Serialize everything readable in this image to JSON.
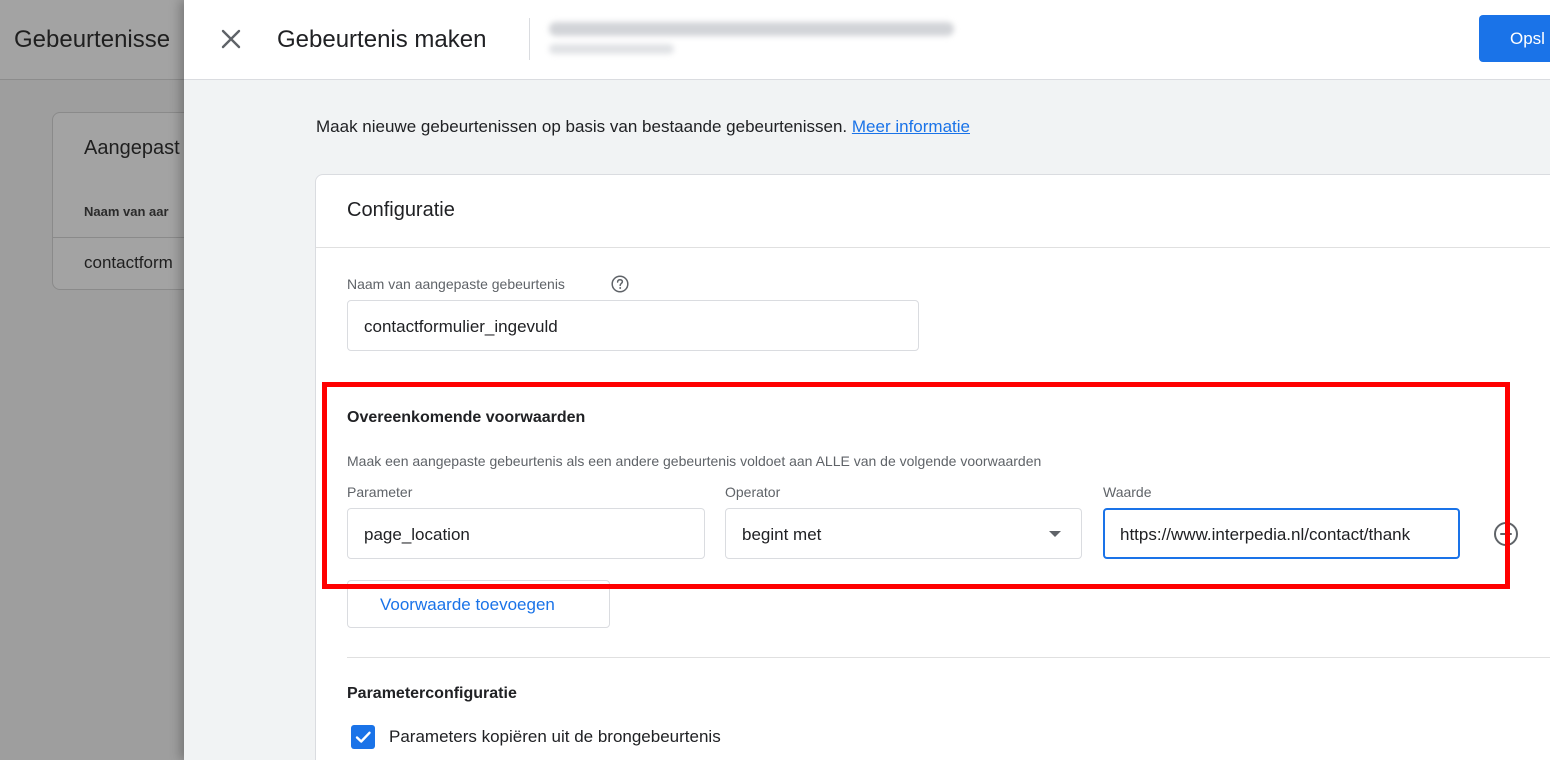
{
  "background": {
    "title": "Gebeurtenisse",
    "card_title": "Aangepast",
    "column_header": "Naam van aar",
    "row_value": "contactform"
  },
  "header": {
    "title": "Gebeurtenis maken",
    "save_label": "Opsl"
  },
  "intro": {
    "text": "Maak nieuwe gebeurtenissen op basis van bestaande gebeurtenissen.",
    "link": "Meer informatie"
  },
  "config": {
    "title": "Configuratie",
    "event_name_label": "Naam van aangepaste gebeurtenis",
    "event_name_value": "contactformulier_ingevuld",
    "conditions_title": "Overeenkomende voorwaarden",
    "conditions_desc": "Maak een aangepaste gebeurtenis als een andere gebeurtenis voldoet aan ALLE van de volgende voorwaarden",
    "condition": {
      "parameter_label": "Parameter",
      "parameter_value": "page_location",
      "operator_label": "Operator",
      "operator_value": "begint met",
      "value_label": "Waarde",
      "value_value": "https://www.interpedia.nl/contact/thank"
    },
    "add_condition_label": "Voorwaarde toevoegen",
    "param_config_title": "Parameterconfiguratie",
    "copy_params_label": "Parameters kopiëren uit de brongebeurtenis",
    "copy_params_checked": true
  },
  "colors": {
    "accent": "#1a73e8",
    "highlight": "#ff0000"
  }
}
